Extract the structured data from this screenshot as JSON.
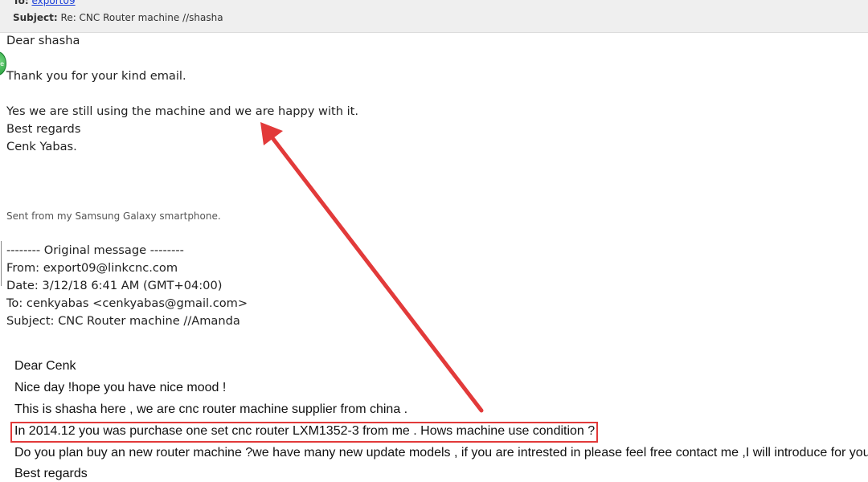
{
  "header": {
    "to_label": "To:",
    "to_value": "export09",
    "subject_label": "Subject:",
    "subject_value": "Re: CNC Router machine //shasha"
  },
  "badge": {
    "icon": "green-status-icon",
    "text": "e"
  },
  "reply": {
    "greeting": "Dear shasha",
    "thanks": "Thank you for your kind email.",
    "body": "Yes we are still using the machine and we are happy with it.",
    "closing": "Best regards",
    "signature": "Cenk Yabas.",
    "sent_from": "Sent from my Samsung Galaxy smartphone."
  },
  "original": {
    "divider": "-------- Original message --------",
    "from": "From: export09@linkcnc.com",
    "date": "Date: 3/12/18 6:41 AM (GMT+04:00)",
    "to": "To: cenkyabas <cenkyabas@gmail.com>",
    "subject": "Subject: CNC Router machine //Amanda"
  },
  "sent_message": {
    "greeting": "Dear Cenk",
    "line1": "Nice day !hope you have nice mood !",
    "line2": "This is shasha here , we are cnc router machine supplier from china .",
    "line3": "In 2014.12 you was purchase one set cnc router LXM1352-3 from me . Hows machine use condition ?",
    "line4": "Do you plan buy an new router machine ?we have many new update models , if you are intrested in please feel free contact me ,I will introduce for you !",
    "closing": "Best regards"
  },
  "annotation": {
    "color": "#e23a3a"
  }
}
